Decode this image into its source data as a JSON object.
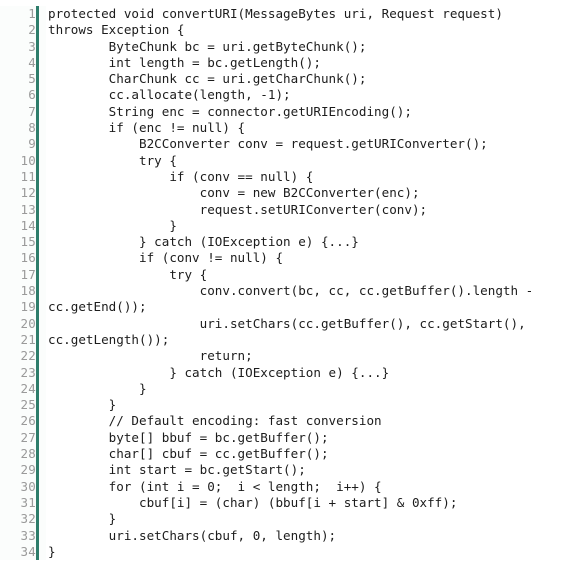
{
  "listing": {
    "language": "java",
    "total_lines": 34,
    "gutter_bar_color": "#2e7d6b",
    "line_number_color": "#9a9a9a",
    "code_text_color": "#1c1c1c",
    "background_color": "#ffffff",
    "lines": [
      {
        "n": "1",
        "code": "protected void convertURI(MessageBytes uri, Request request)"
      },
      {
        "n": "2",
        "code": "throws Exception {"
      },
      {
        "n": "3",
        "code": "        ByteChunk bc = uri.getByteChunk();"
      },
      {
        "n": "4",
        "code": "        int length = bc.getLength();"
      },
      {
        "n": "5",
        "code": "        CharChunk cc = uri.getCharChunk();"
      },
      {
        "n": "6",
        "code": "        cc.allocate(length, -1);"
      },
      {
        "n": "7",
        "code": "        String enc = connector.getURIEncoding();"
      },
      {
        "n": "8",
        "code": "        if (enc != null) {"
      },
      {
        "n": "9",
        "code": "            B2CConverter conv = request.getURIConverter();"
      },
      {
        "n": "10",
        "code": "            try {"
      },
      {
        "n": "11",
        "code": "                if (conv == null) {"
      },
      {
        "n": "12",
        "code": "                    conv = new B2CConverter(enc);"
      },
      {
        "n": "13",
        "code": "                    request.setURIConverter(conv);"
      },
      {
        "n": "14",
        "code": "                }"
      },
      {
        "n": "15",
        "code": "            } catch (IOException e) {...}"
      },
      {
        "n": "16",
        "code": "            if (conv != null) {"
      },
      {
        "n": "17",
        "code": "                try {"
      },
      {
        "n": "18",
        "code": "                    conv.convert(bc, cc, cc.getBuffer().length -"
      },
      {
        "n": "19",
        "code": "cc.getEnd());"
      },
      {
        "n": "20",
        "code": "                    uri.setChars(cc.getBuffer(), cc.getStart(),"
      },
      {
        "n": "21",
        "code": "cc.getLength());"
      },
      {
        "n": "22",
        "code": "                    return;"
      },
      {
        "n": "23",
        "code": "                } catch (IOException e) {...}"
      },
      {
        "n": "24",
        "code": "            }"
      },
      {
        "n": "25",
        "code": "        }"
      },
      {
        "n": "26",
        "code": "        // Default encoding: fast conversion"
      },
      {
        "n": "27",
        "code": "        byte[] bbuf = bc.getBuffer();"
      },
      {
        "n": "28",
        "code": "        char[] cbuf = cc.getBuffer();"
      },
      {
        "n": "29",
        "code": "        int start = bc.getStart();"
      },
      {
        "n": "30",
        "code": "        for (int i = 0;  i < length;  i++) {"
      },
      {
        "n": "31",
        "code": "            cbuf[i] = (char) (bbuf[i + start] & 0xff);"
      },
      {
        "n": "32",
        "code": "        }"
      },
      {
        "n": "33",
        "code": "        uri.setChars(cbuf, 0, length);"
      },
      {
        "n": "34",
        "code": "}"
      }
    ]
  }
}
